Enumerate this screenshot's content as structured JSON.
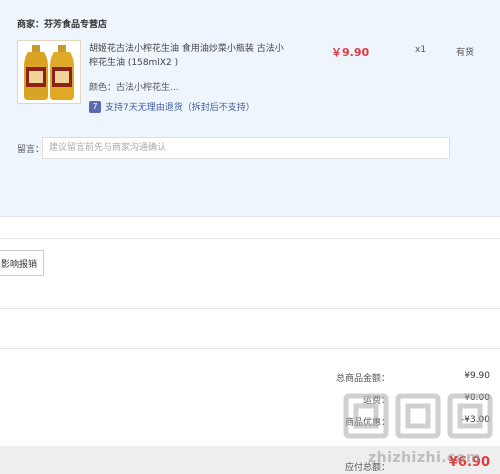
{
  "merchant": {
    "label": "商家：",
    "name": "芬芳食品专营店"
  },
  "product": {
    "image_alt": "胡姬花古法小榨花生油",
    "title": "胡姬花古法小榨花生油 食用油炒菜小瓶装 古法小榨花生油 (158mlX2 )",
    "color_label": "颜色：",
    "color_value": "古法小榨花生...",
    "return_icon": "7",
    "return_policy": "支持7天无理由退货（拆封后不支持）",
    "price": "￥9.90",
    "quantity": "x1",
    "stock": "有货"
  },
  "remark": {
    "label": "留言：",
    "placeholder": "建议留言前先与商家沟通确认"
  },
  "invoice": {
    "button_label": "影响报销"
  },
  "summary": {
    "total_goods_label": "总商品金额：",
    "total_goods_value": "¥9.90",
    "shipping_label": "运费：",
    "shipping_value": "¥0.00",
    "discount_label": "商品优惠：",
    "discount_value": "-¥3.00",
    "payable_label": "应付总额：",
    "payable_value": "¥6.90"
  },
  "watermark": {
    "text": "zhizhizhi.com"
  },
  "colors": {
    "price_red": "#e4393c",
    "panel_bg": "#eef5fd",
    "link_blue": "#445ba0"
  }
}
